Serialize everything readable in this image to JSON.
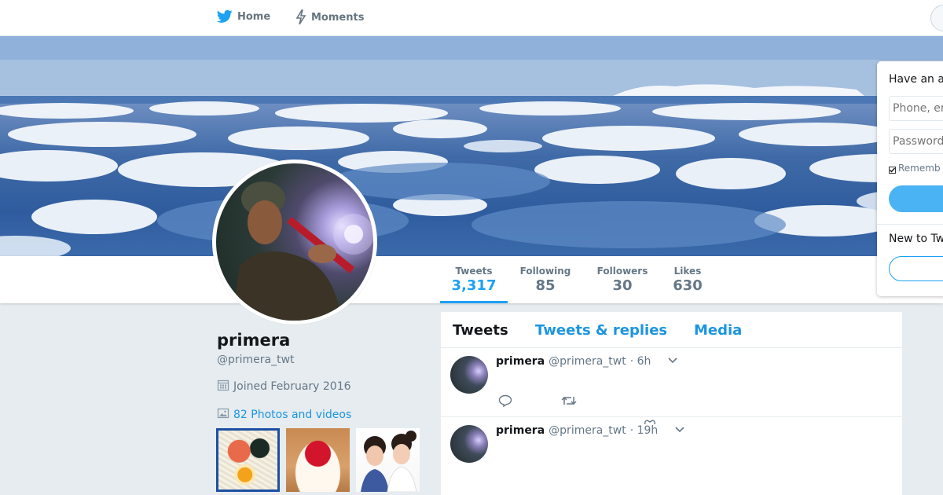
{
  "nav": {
    "home_label": "Home",
    "moments_label": "Moments"
  },
  "profile": {
    "name": "primera",
    "handle": "@primera_twt",
    "joined": "Joined February 2016",
    "photos_link": "82 Photos and videos"
  },
  "stats": [
    {
      "label": "Tweets",
      "value": "3,317"
    },
    {
      "label": "Following",
      "value": "85"
    },
    {
      "label": "Followers",
      "value": "30"
    },
    {
      "label": "Likes",
      "value": "630"
    }
  ],
  "tabs": [
    "Tweets",
    "Tweets & replies",
    "Media"
  ],
  "tweets": [
    {
      "name": "primera",
      "handle": "@primera_twt",
      "time": "· 6h"
    },
    {
      "name": "primera",
      "handle": "@primera_twt",
      "time": "· 19h"
    }
  ],
  "login": {
    "title": "Have an a",
    "phone_placeholder": "Phone, er",
    "password_placeholder": "Password",
    "remember_label": "Rememb",
    "new_to": "New to Tw"
  },
  "colors": {
    "accent": "#1da1f2",
    "link": "#1b95e0"
  },
  "icons": {
    "home": "bird-icon",
    "moments": "lightning-icon",
    "joined": "calendar-icon",
    "photos": "image-icon",
    "reply": "reply-icon",
    "retweet": "retweet-icon",
    "like": "heart-icon",
    "caret": "chevron-down-icon"
  }
}
